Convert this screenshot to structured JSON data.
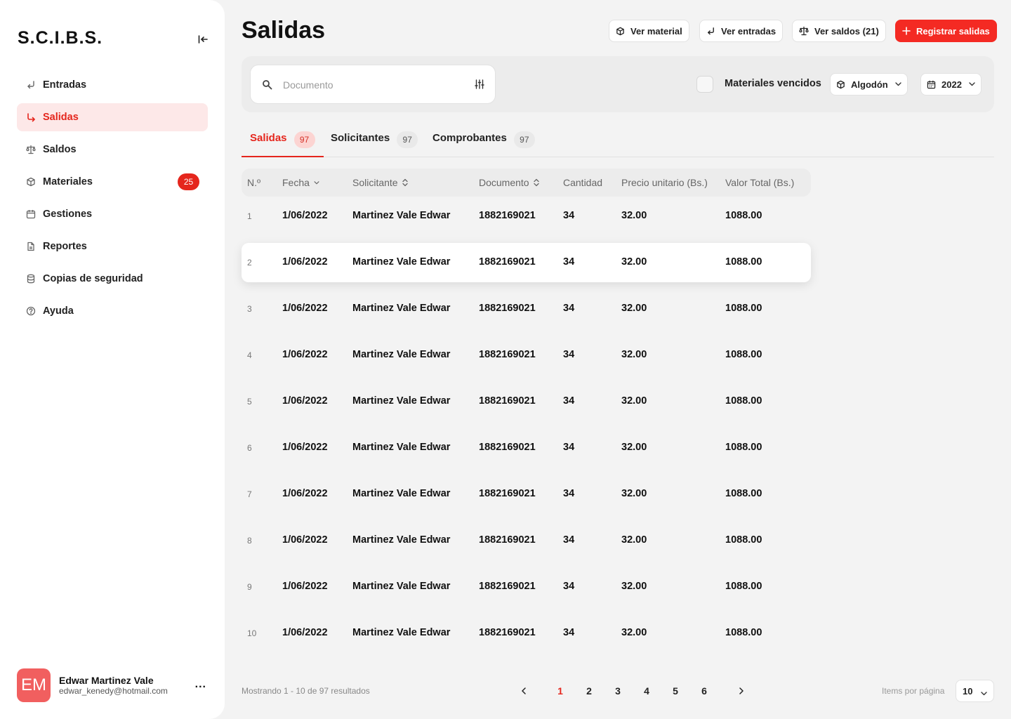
{
  "sidebar": {
    "brand": "S.C.I.B.S.",
    "items": [
      {
        "label": "Entradas",
        "icon": "return-arrow-icon"
      },
      {
        "label": "Salidas",
        "icon": "down-right-arrow-icon",
        "active": true
      },
      {
        "label": "Saldos",
        "icon": "scale-icon"
      },
      {
        "label": "Materiales",
        "icon": "box-icon",
        "badge": "25"
      },
      {
        "label": "Gestiones",
        "icon": "calendar-icon"
      },
      {
        "label": "Reportes",
        "icon": "document-icon"
      },
      {
        "label": "Copias de seguridad",
        "icon": "database-icon"
      },
      {
        "label": "Ayuda",
        "icon": "help-icon"
      }
    ],
    "user": {
      "initials": "EM",
      "name": "Edwar Martinez Vale",
      "email": "edwar_kenedy@hotmail.com",
      "menu": "..."
    }
  },
  "header": {
    "title": "Salidas",
    "buttons": {
      "ver_material": "Ver material",
      "ver_entradas": "Ver entradas",
      "ver_saldos": "Ver saldos (21)",
      "registrar": "Registrar salidas"
    }
  },
  "filters": {
    "search_placeholder": "Documento",
    "search_value": "",
    "expired_label": "Materiales vencidos",
    "material": "Algodón",
    "year": "2022"
  },
  "tabs": [
    {
      "label": "Salidas",
      "count": "97",
      "active": true
    },
    {
      "label": "Solicitantes",
      "count": "97"
    },
    {
      "label": "Comprobantes",
      "count": "97"
    }
  ],
  "table": {
    "headers": {
      "num": "N.º",
      "fecha": "Fecha",
      "solicitante": "Solicitante",
      "documento": "Documento",
      "cantidad": "Cantidad",
      "precio": "Precio unitario (Bs.)",
      "valor": "Valor Total (Bs.)"
    },
    "rows": [
      {
        "num": "1",
        "fecha": "1/06/2022",
        "solicitante": "Martinez Vale Edwar",
        "documento": "1882169021",
        "cantidad": "34",
        "precio": "32.00",
        "valor": "1088.00"
      },
      {
        "num": "2",
        "fecha": "1/06/2022",
        "solicitante": "Martinez Vale Edwar",
        "documento": "1882169021",
        "cantidad": "34",
        "precio": "32.00",
        "valor": "1088.00",
        "highlighted": true
      },
      {
        "num": "3",
        "fecha": "1/06/2022",
        "solicitante": "Martinez Vale Edwar",
        "documento": "1882169021",
        "cantidad": "34",
        "precio": "32.00",
        "valor": "1088.00"
      },
      {
        "num": "4",
        "fecha": "1/06/2022",
        "solicitante": "Martinez Vale Edwar",
        "documento": "1882169021",
        "cantidad": "34",
        "precio": "32.00",
        "valor": "1088.00"
      },
      {
        "num": "5",
        "fecha": "1/06/2022",
        "solicitante": "Martinez Vale Edwar",
        "documento": "1882169021",
        "cantidad": "34",
        "precio": "32.00",
        "valor": "1088.00"
      },
      {
        "num": "6",
        "fecha": "1/06/2022",
        "solicitante": "Martinez Vale Edwar",
        "documento": "1882169021",
        "cantidad": "34",
        "precio": "32.00",
        "valor": "1088.00"
      },
      {
        "num": "7",
        "fecha": "1/06/2022",
        "solicitante": "Martinez Vale Edwar",
        "documento": "1882169021",
        "cantidad": "34",
        "precio": "32.00",
        "valor": "1088.00"
      },
      {
        "num": "8",
        "fecha": "1/06/2022",
        "solicitante": "Martinez Vale Edwar",
        "documento": "1882169021",
        "cantidad": "34",
        "precio": "32.00",
        "valor": "1088.00"
      },
      {
        "num": "9",
        "fecha": "1/06/2022",
        "solicitante": "Martinez Vale Edwar",
        "documento": "1882169021",
        "cantidad": "34",
        "precio": "32.00",
        "valor": "1088.00"
      },
      {
        "num": "10",
        "fecha": "1/06/2022",
        "solicitante": "Martinez Vale Edwar",
        "documento": "1882169021",
        "cantidad": "34",
        "precio": "32.00",
        "valor": "1088.00"
      }
    ]
  },
  "footer": {
    "showing": "Mostrando 1 - 10 de 97 resultados",
    "pages": [
      "1",
      "2",
      "3",
      "4",
      "5",
      "6"
    ],
    "current_page": "1",
    "items_per_page_label": "Items por página",
    "items_per_page": "10"
  },
  "colors": {
    "accent": "#e5261d",
    "primary_button": "#f42a23",
    "active_bg": "#fde8e8",
    "avatar": "#f15f5f"
  }
}
